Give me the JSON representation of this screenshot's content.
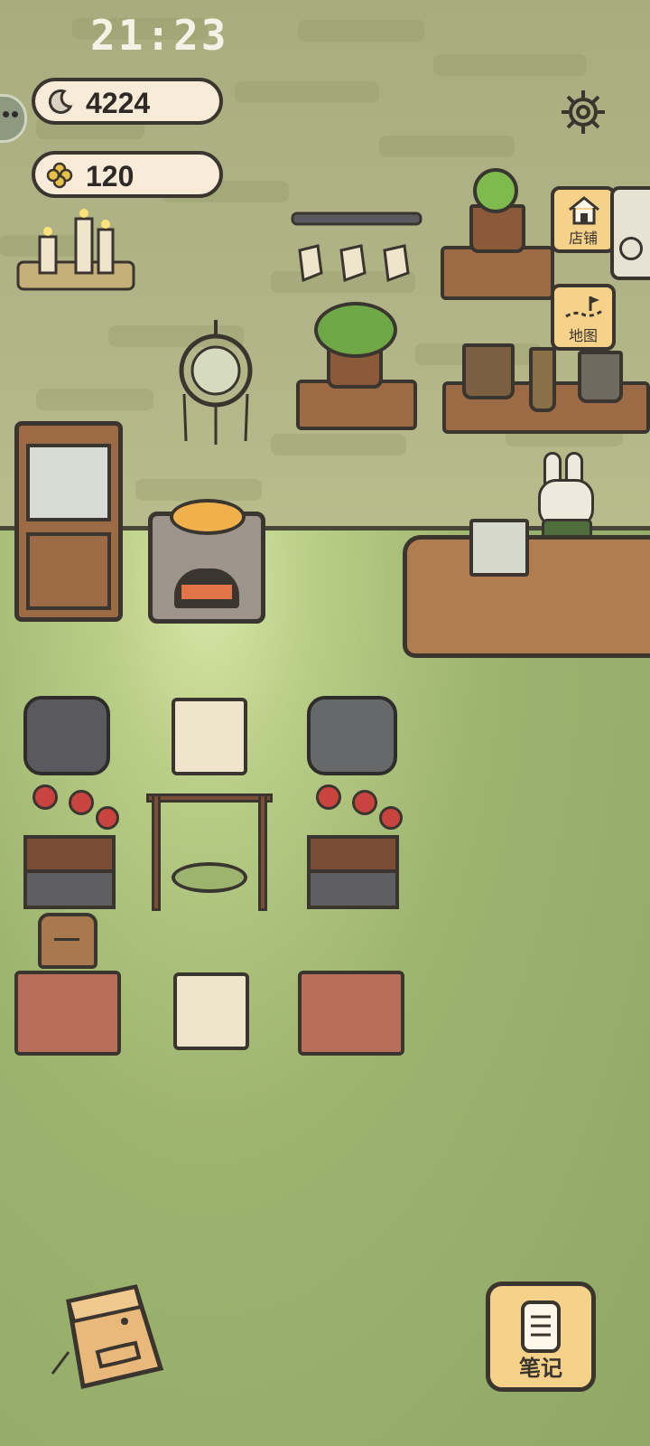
{
  "status_bar": {
    "time": "21:23"
  },
  "currency": {
    "moons": {
      "value": "4224",
      "icon": "moon-icon"
    },
    "clovers": {
      "value": "120",
      "icon": "clover-icon"
    }
  },
  "side_menu": {
    "shop_label": "店铺",
    "map_label": "地图"
  },
  "bottom_bar": {
    "notes_label": "笔记",
    "bag_icon": "backpack-icon"
  },
  "colors": {
    "accent_button": "#f6d189",
    "outline": "#3b3530",
    "pill_bg": "#f8ecd9"
  }
}
